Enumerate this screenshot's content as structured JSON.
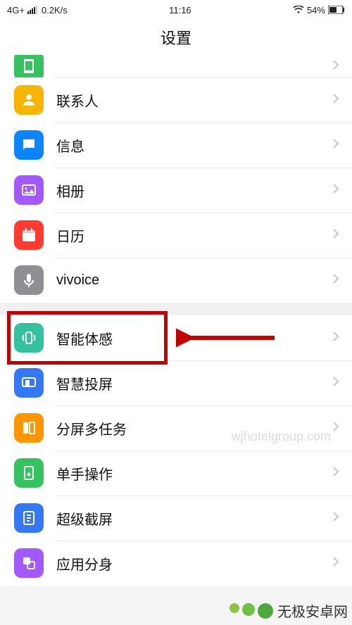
{
  "status": {
    "network": "4G+",
    "speed": "0.2K/s",
    "time": "11:16",
    "battery_pct": "54%"
  },
  "title": "设置",
  "rows": [
    {
      "label": "",
      "icon": "phone-icon",
      "color": "bg-green",
      "partial": true
    },
    {
      "label": "联系人",
      "icon": "contacts-icon",
      "color": "bg-yellow"
    },
    {
      "label": "信息",
      "icon": "messages-icon",
      "color": "bg-blue"
    },
    {
      "label": "相册",
      "icon": "gallery-icon",
      "color": "bg-purple"
    },
    {
      "label": "日历",
      "icon": "calendar-icon",
      "color": "bg-red"
    },
    {
      "label": "vivoice",
      "icon": "mic-icon",
      "color": "bg-gray"
    }
  ],
  "rows2": [
    {
      "label": "智能体感",
      "icon": "motion-icon",
      "color": "bg-teal",
      "highlighted": true
    },
    {
      "label": "智慧投屏",
      "icon": "cast-icon",
      "color": "bg-bluep"
    },
    {
      "label": "分屏多任务",
      "icon": "split-icon",
      "color": "bg-orange"
    },
    {
      "label": "单手操作",
      "icon": "onehand-icon",
      "color": "bg-green"
    },
    {
      "label": "超级截屏",
      "icon": "screenshot-icon",
      "color": "bg-bluep"
    },
    {
      "label": "应用分身",
      "icon": "clone-icon",
      "color": "bg-purple"
    }
  ],
  "watermark": "wjhotelgroup.com",
  "logo_text": "无极安卓网",
  "logo_url": "wjhotelgroup.com"
}
